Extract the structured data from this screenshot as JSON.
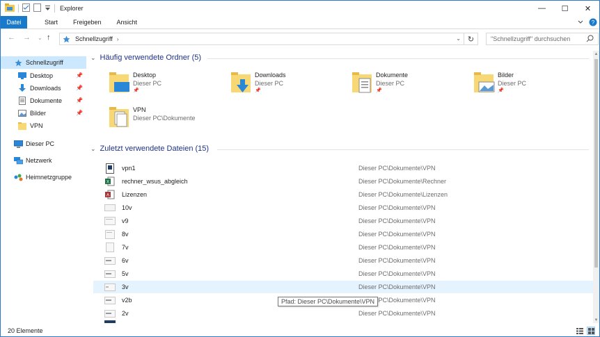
{
  "window": {
    "title": "Explorer",
    "minimize_symbol": "—",
    "maximize_symbol": "☐",
    "close_symbol": "✕"
  },
  "ribbon": {
    "tabs": [
      "Datei",
      "Start",
      "Freigeben",
      "Ansicht"
    ]
  },
  "address": {
    "crumb": "Schnellzugriff",
    "crumb_arrow": "›",
    "search_placeholder": "\"Schnellzugriff\" durchsuchen"
  },
  "nav_pane": {
    "items": [
      {
        "label": "Schnellzugriff",
        "icon": "star-icon",
        "pinned": false,
        "indent": 0,
        "selected": true
      },
      {
        "label": "Desktop",
        "icon": "desktop-icon",
        "pinned": true,
        "indent": 1
      },
      {
        "label": "Downloads",
        "icon": "download-icon",
        "pinned": true,
        "indent": 1
      },
      {
        "label": "Dokumente",
        "icon": "documents-icon",
        "pinned": true,
        "indent": 1
      },
      {
        "label": "Bilder",
        "icon": "pictures-icon",
        "pinned": true,
        "indent": 1
      },
      {
        "label": "VPN",
        "icon": "folder-icon",
        "pinned": false,
        "indent": 1
      },
      {
        "label": "Dieser PC",
        "icon": "computer-icon",
        "pinned": false,
        "indent": 0
      },
      {
        "label": "Netzwerk",
        "icon": "network-icon",
        "pinned": false,
        "indent": 0
      },
      {
        "label": "Heimnetzgruppe",
        "icon": "homegroup-icon",
        "pinned": false,
        "indent": 0
      }
    ]
  },
  "frequent": {
    "header": "Häufig verwendete Ordner (5)",
    "folders": [
      {
        "name": "Desktop",
        "path": "Dieser PC",
        "pinned": true,
        "overlay": "desktop"
      },
      {
        "name": "Downloads",
        "path": "Dieser PC",
        "pinned": true,
        "overlay": "download"
      },
      {
        "name": "Dokumente",
        "path": "Dieser PC",
        "pinned": true,
        "overlay": "document"
      },
      {
        "name": "Bilder",
        "path": "Dieser PC",
        "pinned": true,
        "overlay": "picture"
      },
      {
        "name": "VPN",
        "path": "Dieser PC\\Dokumente",
        "pinned": false,
        "overlay": "files"
      }
    ]
  },
  "recent": {
    "header": "Zuletzt verwendete Dateien (15)",
    "files": [
      {
        "name": "vpn1",
        "location": "Dieser PC\\Dokumente\\VPN",
        "icon": "vpn-config-icon"
      },
      {
        "name": "rechner_wsus_abgleich",
        "location": "Dieser PC\\Dokumente\\Rechner",
        "icon": "excel-icon"
      },
      {
        "name": "Lizenzen",
        "location": "Dieser PC\\Dokumente\\Lizenzen",
        "icon": "access-icon"
      },
      {
        "name": "10v",
        "location": "Dieser PC\\Dokumente\\VPN",
        "icon": "file-thumb-icon"
      },
      {
        "name": "v9",
        "location": "Dieser PC\\Dokumente\\VPN",
        "icon": "file-thumb-icon"
      },
      {
        "name": "8v",
        "location": "Dieser PC\\Dokumente\\VPN",
        "icon": "file-thumb-icon"
      },
      {
        "name": "7v",
        "location": "Dieser PC\\Dokumente\\VPN",
        "icon": "file-thumb-icon"
      },
      {
        "name": "6v",
        "location": "Dieser PC\\Dokumente\\VPN",
        "icon": "file-thumb-icon"
      },
      {
        "name": "5v",
        "location": "Dieser PC\\Dokumente\\VPN",
        "icon": "file-thumb-icon"
      },
      {
        "name": "3v",
        "location": "Dieser PC\\Dokumente\\VPN",
        "icon": "file-thumb-icon",
        "hover": true
      },
      {
        "name": "v2b",
        "location": "Dieser PC\\Dokumente\\VPN",
        "icon": "file-thumb-icon"
      },
      {
        "name": "2v",
        "location": "Dieser PC\\Dokumente\\VPN",
        "icon": "file-thumb-icon"
      }
    ],
    "tooltip": "Pfad: Dieser PC\\Dokumente\\VPN"
  },
  "status": {
    "count": "20 Elemente"
  },
  "colors": {
    "accent": "#1979ca",
    "header_text": "#1e3287",
    "selection": "#cce8ff",
    "hover": "#e5f3ff"
  }
}
